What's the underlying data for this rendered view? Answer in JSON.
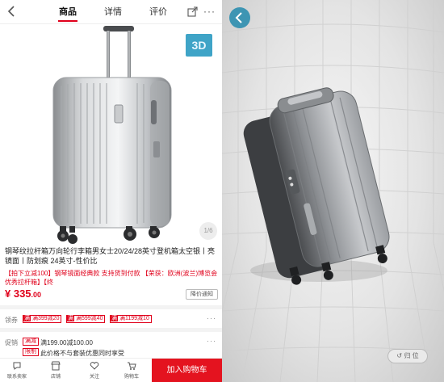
{
  "topbar": {
    "tabs": [
      {
        "label": "商品",
        "active": true
      },
      {
        "label": "详情",
        "active": false
      },
      {
        "label": "评价",
        "active": false
      }
    ],
    "more": "···"
  },
  "gallery": {
    "badge": "3D",
    "page_indicator": "1/6"
  },
  "product": {
    "title": "钢琴纹拉杆箱万向轮行李箱男女士20/24/28英寸登机箱太空银丨亮镜面丨防划痕 24英寸-性价比",
    "promo": "【拍下立减100】钢琴镜面经典款 支持货到付款 【荣获：欧洲(波兰)博览会优秀拉杆箱】【终",
    "price": "¥ 335",
    "price_decimal": ".00",
    "notify_label": "降价通知"
  },
  "coupons": {
    "label": "领券",
    "items": [
      {
        "tag": "满",
        "text": "满399减20"
      },
      {
        "tag": "满",
        "text": "满599减40"
      },
      {
        "tag": "满",
        "text": "满1199减10"
      }
    ],
    "more": "···"
  },
  "promotion": {
    "label": "促销",
    "rows": [
      {
        "tag": "满减",
        "text": "满199.00减100.00"
      },
      {
        "tag": "限制",
        "text": "此价格不与套装优惠同时享受"
      }
    ],
    "more": "···"
  },
  "bottombar": {
    "items": [
      {
        "label": "联系卖家",
        "icon": "chat-icon"
      },
      {
        "label": "店铺",
        "icon": "store-icon"
      },
      {
        "label": "关注",
        "icon": "heart-icon"
      },
      {
        "label": "购物车",
        "icon": "cart-icon"
      }
    ],
    "cart_button": "加入购物车"
  },
  "viewer3d": {
    "reset_label": "归 位"
  },
  "colors": {
    "accent": "#e0001b",
    "badge_3d": "#3fa4c7",
    "viewer_back": "#3d95b3"
  }
}
